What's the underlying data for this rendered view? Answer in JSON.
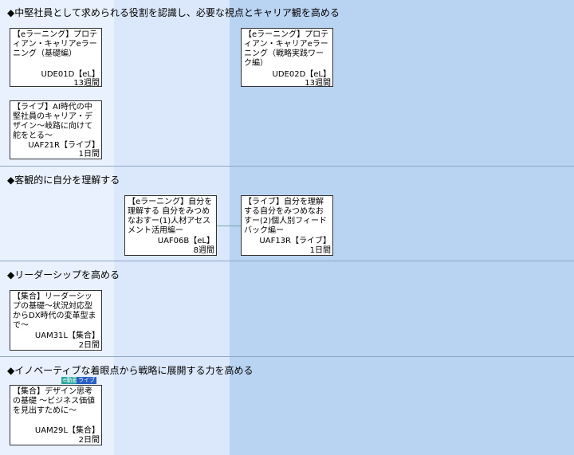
{
  "sections": [
    {
      "title": "◆中堅社員として求められる役割を認識し、必要な視点とキャリア観を高める"
    },
    {
      "title": "◆客観的に自分を理解する"
    },
    {
      "title": "◆リーダーシップを高める"
    },
    {
      "title": "◆イノベーティブな着眼点から戦略に展開する力を高める"
    }
  ],
  "cards": [
    {
      "name": "【eラーニング】プロティアン・キャリアeラーニング（基礎編）",
      "code": "UDE01D【eL】",
      "duration": "13週間"
    },
    {
      "name": "【eラーニング】プロティアン・キャリアeラーニング（戦略実践ワーク編）",
      "code": "UDE02D【eL】",
      "duration": "13週間"
    },
    {
      "name": "【ライブ】AI時代の中堅社員のキャリア・デザイン～岐路に向けて舵をとる～",
      "code": "UAF21R【ライブ】",
      "duration": "1日間"
    },
    {
      "name": "【eラーニング】自分を理解する 自分をみつめなおすー(1)人材アセスメント活用編ー",
      "code": "UAF06B【eL】",
      "duration": "8週間"
    },
    {
      "name": "【ライブ】自分を理解する自分をみつめなおすー(2)個人別フィードバック編ー",
      "code": "UAF13R【ライブ】",
      "duration": "1日間"
    },
    {
      "name": "【集合】リーダーシップの基礎～状況対応型からDX時代の変革型まで～",
      "code": "UAM31L【集合】",
      "duration": "2日間"
    },
    {
      "name": "【集合】デザイン思考の基礎 ～ビジネス価値を見出すために～",
      "code": "UAM29L【集合】",
      "duration": "2日間"
    }
  ],
  "tags": {
    "video": "e動画",
    "live": "ライブ"
  },
  "colors": {
    "tag_video": "#2ea8a0",
    "tag_live": "#2b5fc4"
  }
}
